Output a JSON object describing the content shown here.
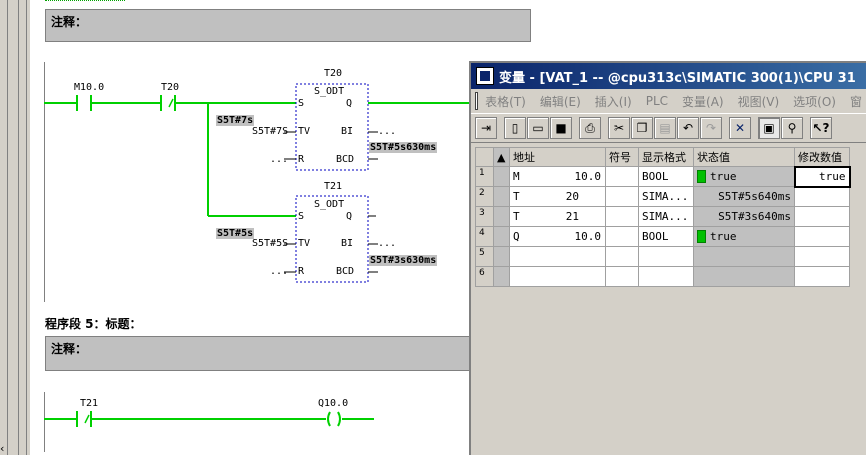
{
  "editor": {
    "comment_label": "注释：",
    "network4": {
      "contact1": "M10.0",
      "contact2": "T20",
      "timer1": {
        "name": "T20",
        "type": "S_ODT",
        "pin_s": "S",
        "pin_q": "Q",
        "pin_tv": "TV",
        "pin_bi": "BI",
        "pin_r": "R",
        "pin_bcd": "BCD",
        "tv_value": "S5T#7s",
        "tv_echo": "S5T#7S",
        "bi_out": "...",
        "r_in": "...",
        "bcd_out": "S5T#5s630ms"
      },
      "timer2": {
        "name": "T21",
        "type": "S_ODT",
        "pin_s": "S",
        "pin_q": "Q",
        "pin_tv": "TV",
        "pin_bi": "BI",
        "pin_r": "R",
        "pin_bcd": "BCD",
        "tv_value": "S5T#5s",
        "tv_echo": "S5T#5S",
        "bi_out": "...",
        "r_in": "...",
        "bcd_out": "S5T#3s630ms"
      }
    },
    "network5": {
      "title": "程序段 5：标题：",
      "comment_label": "注释：",
      "contact": "T21",
      "coil": "Q10.0"
    }
  },
  "vat": {
    "title": "变量 - [VAT_1 -- @cpu313c\\SIMATIC 300(1)\\CPU 31",
    "menu": [
      "表格(T)",
      "编辑(E)",
      "插入(I)",
      "PLC",
      "变量(A)",
      "视图(V)",
      "选项(O)",
      "窗"
    ],
    "headers": {
      "address": "地址",
      "symbol": "符号",
      "format": "显示格式",
      "status": "状态值",
      "modify": "修改数值"
    },
    "rows": [
      {
        "n": "1",
        "area": "M",
        "addr": "10.0",
        "symbol": "",
        "format": "BOOL",
        "status": "true",
        "status_green": true,
        "modify": "true"
      },
      {
        "n": "2",
        "area": "T",
        "addr": "20",
        "symbol": "",
        "format": "SIMA...",
        "status": "S5T#5s640ms",
        "status_green": false,
        "modify": ""
      },
      {
        "n": "3",
        "area": "T",
        "addr": "21",
        "symbol": "",
        "format": "SIMA...",
        "status": "S5T#3s640ms",
        "status_green": false,
        "modify": ""
      },
      {
        "n": "4",
        "area": "Q",
        "addr": "10.0",
        "symbol": "",
        "format": "BOOL",
        "status": "true",
        "status_green": true,
        "modify": ""
      },
      {
        "n": "5",
        "area": "",
        "addr": "",
        "symbol": "",
        "format": "",
        "status": "",
        "status_green": false,
        "modify": ""
      },
      {
        "n": "6",
        "area": "",
        "addr": "",
        "symbol": "",
        "format": "",
        "status": "",
        "status_green": false,
        "modify": ""
      }
    ],
    "colors": {
      "active_green": "#00ff00",
      "title_blue": "#0a246a"
    }
  }
}
